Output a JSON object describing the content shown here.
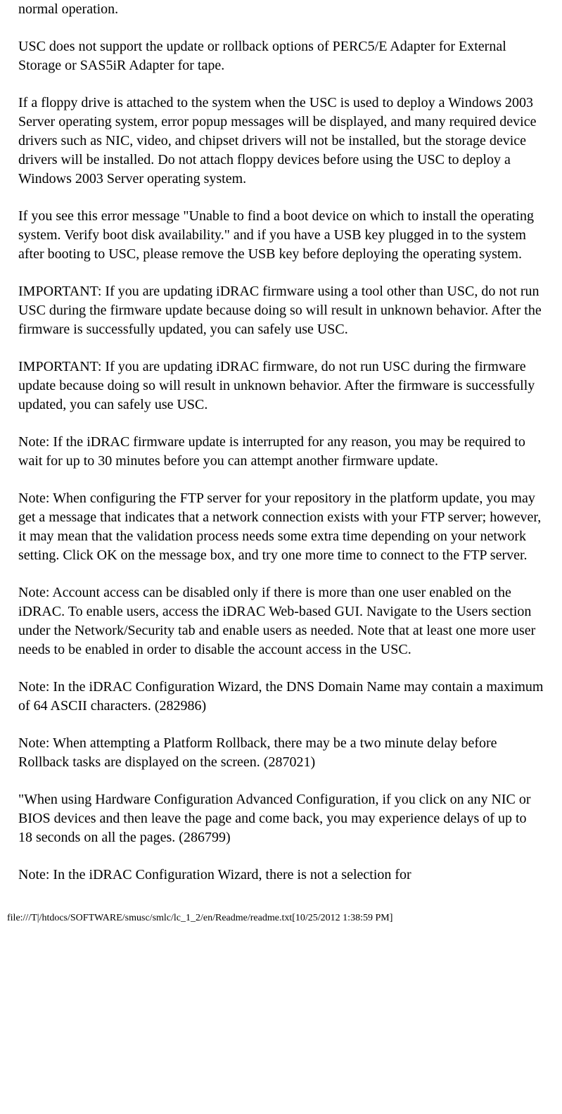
{
  "paragraphs": [
    "normal operation.",
    "USC does not support the update or rollback options of PERC5/E Adapter for External Storage or SAS5iR Adapter for tape.",
    "If a floppy drive is attached to the system when the USC is used to deploy a Windows 2003 Server operating system, error popup messages will be displayed, and many required device drivers such as NIC, video, and chipset drivers will not be installed, but the storage device drivers will be installed. Do not attach floppy devices before using the USC to deploy a Windows 2003 Server operating system.",
    "If you see this error message \"Unable to find a boot device on which to install the operating system. Verify boot disk availability.\" and if you have a USB key plugged in to the system after booting to USC, please remove the USB key before deploying the operating system.",
    "IMPORTANT: If you are updating iDRAC firmware using a tool other than USC, do not run USC during the firmware update because doing so will result in unknown behavior. After the firmware is successfully updated, you can safely use USC.",
    "IMPORTANT: If you are updating iDRAC firmware, do not run USC during the firmware update because doing so will result in unknown behavior. After the firmware is successfully updated, you can safely use USC.",
    "Note: If the iDRAC firmware update is interrupted for any reason, you may be required to wait for up to 30 minutes before you can attempt another firmware update.",
    "Note: When configuring the FTP server for your repository in the platform update, you may get a message that indicates that a network connection exists with your FTP server; however, it may mean that the validation process needs some extra time depending on your network setting. Click OK on the message box, and try one more time to connect to the FTP server.",
    "Note: Account access can be disabled only if there is more than one user enabled on the iDRAC. To enable users, access the iDRAC Web-based GUI. Navigate to the Users section under the Network/Security tab and enable users as needed. Note that at least one more user needs to be enabled in order to disable the account access in the USC.",
    "Note: In the iDRAC Configuration Wizard, the DNS Domain Name may contain a maximum of 64 ASCII characters. (282986)",
    "Note: When attempting a Platform Rollback, there may be a two minute delay before Rollback tasks are displayed on the screen. (287021)",
    "\"When using Hardware Configuration Advanced Configuration, if you click on any NIC or BIOS devices and then leave the page and come back, you may experience delays of up to 18 seconds on all the pages. (286799)",
    "Note: In the iDRAC Configuration Wizard, there is not a selection for"
  ],
  "footer": "file:///T|/htdocs/SOFTWARE/smusc/smlc/lc_1_2/en/Readme/readme.txt[10/25/2012 1:38:59 PM]"
}
